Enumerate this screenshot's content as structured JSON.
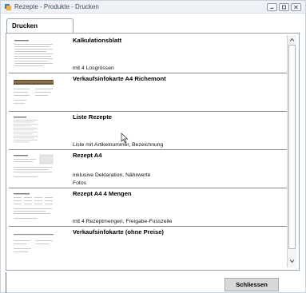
{
  "window": {
    "title": "Rezepte - Produkte - Drucken"
  },
  "tabs": [
    {
      "label": "Drucken",
      "active": true
    }
  ],
  "print_items": [
    {
      "title": "Kalkulationsblatt",
      "lines": [
        "mit 4 Losgrössen"
      ]
    },
    {
      "title": "Verkaufsinfokarte A4 Richemont",
      "lines": []
    },
    {
      "title": "Liste Rezepte",
      "lines": [
        "Liste mit Artikelnummer, Bezeichnung"
      ]
    },
    {
      "title": "Rezept A4",
      "lines": [
        "inklusive Deklaration, Nährwerte",
        "Fotos"
      ]
    },
    {
      "title": "Rezept A4 4 Mengen",
      "lines": [
        "mit 4 Rezeptmengen, Freigabe-Fusszeile"
      ]
    },
    {
      "title": "Verkaufsinfokarte (ohne Preise)",
      "lines": []
    }
  ],
  "buttons": {
    "close_label": "Schliessen"
  },
  "colors": {
    "titlebar": "#eef2f7",
    "border": "#9aa3ad",
    "row_separator": "#7c8794",
    "button_bg": "#d8d8d8"
  },
  "icons": {
    "app": "app-printer-icon",
    "minimize": "minimize-icon",
    "maximize": "maximize-icon",
    "close": "close-icon"
  }
}
